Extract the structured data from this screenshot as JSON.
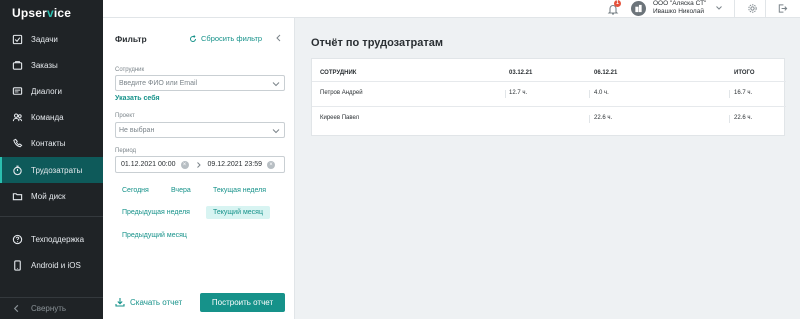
{
  "brand": {
    "logo_left": "Upser",
    "logo_v": "v",
    "logo_right": "ice"
  },
  "sidebar": {
    "items": [
      {
        "label": "Задачи",
        "icon": "tasks-icon"
      },
      {
        "label": "Заказы",
        "icon": "orders-icon"
      },
      {
        "label": "Диалоги",
        "icon": "dialogs-icon"
      },
      {
        "label": "Команда",
        "icon": "team-icon"
      },
      {
        "label": "Контакты",
        "icon": "contacts-icon"
      },
      {
        "label": "Трудозатраты",
        "icon": "timer-icon",
        "active": true
      },
      {
        "label": "Мой диск",
        "icon": "folder-icon"
      }
    ],
    "support": [
      {
        "label": "Техподдержка",
        "icon": "help-icon"
      },
      {
        "label": "Android и iOS",
        "icon": "mobile-icon"
      }
    ],
    "collapse_label": "Свернуть"
  },
  "topbar": {
    "notification_count": "1",
    "org_name": "ООО \"Аляска СТ\"",
    "user_name": "Ивашко Николай"
  },
  "filter": {
    "title": "Фильтр",
    "reset_label": "Сбросить фильтр",
    "employee_label": "Сотрудник",
    "employee_placeholder": "Введите ФИО или Email",
    "show_self": "Указать себя",
    "project_label": "Проект",
    "project_value": "Не выбран",
    "period_label": "Период",
    "period_from": "01.12.2021 00:00",
    "period_to": "09.12.2021 23:59",
    "quick": {
      "today": "Сегодня",
      "yesterday": "Вчера",
      "this_week": "Текущая неделя",
      "prev_week": "Предыдущая неделя",
      "this_month": "Текущий месяц",
      "prev_month": "Предыдущий месяц"
    },
    "download_label": "Скачать отчет",
    "build_label": "Построить отчет"
  },
  "report": {
    "title": "Отчёт по трудозатратам",
    "headers": [
      "СОТРУДНИК",
      "03.12.21",
      "06.12.21",
      "ИТОГО"
    ],
    "rows": [
      [
        "Петров Андрей",
        "12.7 ч.",
        "4.0 ч.",
        "16.7 ч."
      ],
      [
        "Киреев Павел",
        "",
        "22.6 ч.",
        "22.6 ч."
      ]
    ]
  },
  "colors": {
    "accent": "#16928a",
    "sidebar_bg": "#1f2326",
    "active_bg": "#0e5a5a"
  }
}
